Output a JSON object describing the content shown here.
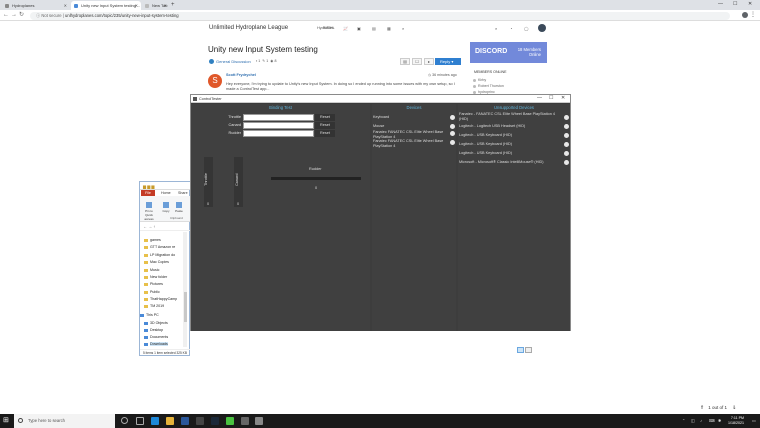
{
  "browser": {
    "tabs": [
      {
        "label": "Hydroplanes",
        "active": false
      },
      {
        "label": "Unity new Input System testing ...",
        "active": true
      },
      {
        "label": "New Tab",
        "active": false
      }
    ],
    "new_tab_glyph": "+",
    "window_controls": [
      "—",
      "☐",
      "✕"
    ],
    "security_label": "Not secure",
    "url": "unlhydroplanes.com/topic/235/unity-new-input-system-testing"
  },
  "forum": {
    "site_title": "Unlimited Hydroplane League",
    "nav": [
      "HydroSim",
      "SIMHL"
    ],
    "topic_title": "Unity new Input System testing",
    "category": "General Discussion",
    "meta": [
      "1",
      "1",
      "8"
    ],
    "toolbar_icons": [
      "sort-icon",
      "watch-icon",
      "share-icon"
    ],
    "reply_label": "Reply",
    "post": {
      "avatar_letter": "S",
      "author": "Scott Frydrychel",
      "time": "36 minutes ago",
      "body": "Hey everyone, I'm trying to update to Unity's new Input System. In doing so I ended up running into some issues with my own setup, so I made a ControlTest app..."
    }
  },
  "discord": {
    "logo": "DISCORD",
    "members_count": "18 Members",
    "members_status": "Online",
    "online_heading": "MEMBERS ONLINE",
    "online": [
      "Kirby",
      "Robert Thurston",
      "hydroprinc"
    ]
  },
  "control_tester": {
    "title": "ControlTester",
    "binding": {
      "heading": "Binding Test",
      "rows": [
        {
          "label": "Throttle",
          "reset": "Reset"
        },
        {
          "label": "Canard",
          "reset": "Reset"
        },
        {
          "label": "Rudder",
          "reset": "Reset"
        }
      ],
      "gauges": [
        {
          "label": "Throttle",
          "value": "0"
        },
        {
          "label": "Canard",
          "value": "0"
        }
      ],
      "rudder": {
        "label": "Rudder",
        "value": "0"
      }
    },
    "devices": {
      "heading": "Devices",
      "items": [
        "Keyboard",
        "Mouse",
        "Fanatec FANATEC CSL Elite Wheel Base PlayStation 4",
        "Fanatec FANATEC CSL Elite Wheel Base PlayStation 4"
      ]
    },
    "unsupported": {
      "heading": "Unsupported Devices",
      "items": [
        "Fanatec - FANATEC CSL Elite Wheel Base PlayStation 4 (HID)",
        "Logitech - Logitech USB Headset (HID)",
        "Logitech - USB Keyboard (HID)",
        "Logitech - USB Keyboard (HID)",
        "Logitech - USB Keyboard (HID)",
        "Microsoft - Microsoft® Classic IntelliMouse® (HID)"
      ]
    }
  },
  "explorer": {
    "file_tab": "File",
    "tabs": [
      "Home",
      "Share"
    ],
    "ribbon": [
      "Pin to Quick access",
      "Copy",
      "Paste"
    ],
    "clipboard_label": "Clipboard",
    "tree": [
      "games",
      "GTT Amazon re",
      "LP Migration do",
      "Mac Copies",
      "Music",
      "New folder",
      "Pictures",
      "Public",
      "ThatHappyCamp",
      "TM 2019"
    ],
    "pc_label": "This PC",
    "pc_items": [
      "3D Objects",
      "Desktop",
      "Documents",
      "Downloads"
    ],
    "status": "5 items    1 item selected 325 KB"
  },
  "pager": {
    "text": "1 out of 1"
  },
  "taskbar": {
    "search_placeholder": "Type here to search",
    "time": "7:11 PM",
    "date": "1/18/2021"
  }
}
